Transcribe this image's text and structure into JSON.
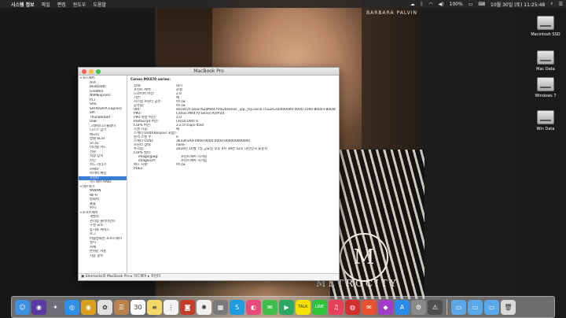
{
  "menubar": {
    "apple": "",
    "items": [
      "시스템 정보",
      "파일",
      "편집",
      "윈도우",
      "도움말"
    ],
    "battery": "100%",
    "clock": "10월 30일 (토) 11:25:48"
  },
  "wallpaper": {
    "brand": "BARBARA PALVIN",
    "logo": "M",
    "wordmark": "METROCITY"
  },
  "desktop": {
    "icons": [
      {
        "label": "Macintosh SSD"
      },
      {
        "label": "Mac Data"
      },
      {
        "label": "Windows 7"
      },
      {
        "label": "Win Data"
      }
    ]
  },
  "window": {
    "title": "MacBook Pro",
    "sidebar": [
      {
        "label": "하드웨어",
        "kind": "cat"
      },
      {
        "label": "ATA",
        "kind": "item"
      },
      {
        "label": "Bluetooth",
        "kind": "item"
      },
      {
        "label": "FireWire",
        "kind": "item"
      },
      {
        "label": "NVMExpress",
        "kind": "item"
      },
      {
        "label": "PCI",
        "kind": "item"
      },
      {
        "label": "SAS",
        "kind": "item"
      },
      {
        "label": "SATA/SATA Express",
        "kind": "item"
      },
      {
        "label": "SPI",
        "kind": "item"
      },
      {
        "label": "Thunderbolt",
        "kind": "item"
      },
      {
        "label": "USB",
        "kind": "item"
      },
      {
        "label": "그래픽/디스플레이",
        "kind": "item"
      },
      {
        "label": "디스크 굽기",
        "kind": "item"
      },
      {
        "label": "메모리",
        "kind": "item"
      },
      {
        "label": "병렬 SCSI",
        "kind": "item"
      },
      {
        "label": "오디오",
        "kind": "item"
      },
      {
        "label": "이더넷 카드",
        "kind": "item"
      },
      {
        "label": "전원",
        "kind": "item"
      },
      {
        "label": "저장 장치",
        "kind": "item"
      },
      {
        "label": "진단",
        "kind": "item"
      },
      {
        "label": "카드 리더기",
        "kind": "item"
      },
      {
        "label": "카메라",
        "kind": "item"
      },
      {
        "label": "파이버 채널",
        "kind": "item"
      },
      {
        "label": "프린터",
        "kind": "item",
        "selected": true
      },
      {
        "label": "하드웨어 RAID",
        "kind": "item"
      },
      {
        "label": "네트워크",
        "kind": "cat"
      },
      {
        "label": "WWAN",
        "kind": "item"
      },
      {
        "label": "Wi-Fi",
        "kind": "item"
      },
      {
        "label": "방화벽",
        "kind": "item"
      },
      {
        "label": "볼륨",
        "kind": "item"
      },
      {
        "label": "위치",
        "kind": "item"
      },
      {
        "label": "소프트웨어",
        "kind": "cat"
      },
      {
        "label": "개발자",
        "kind": "item"
      },
      {
        "label": "관리형 클라이언트",
        "kind": "item"
      },
      {
        "label": "구성 요소",
        "kind": "item"
      },
      {
        "label": "동기화 서비스",
        "kind": "item"
      },
      {
        "label": "로그",
        "kind": "item"
      },
      {
        "label": "비활성화된 소프트웨어",
        "kind": "item"
      },
      {
        "label": "설치",
        "kind": "item"
      },
      {
        "label": "서체",
        "kind": "item"
      },
      {
        "label": "손쉬운 사용",
        "kind": "item"
      },
      {
        "label": "시동 항목",
        "kind": "item"
      }
    ],
    "content": {
      "heading": "Canon MX470 series:",
      "properties": [
        {
          "k": "상태:",
          "v": "대기",
          "indent": 0
        },
        {
          "k": "프린트 서버:",
          "v": "로컬",
          "indent": 0
        },
        {
          "k": "드라이버 버전:",
          "v": "2.0",
          "indent": 0
        },
        {
          "k": "기본:",
          "v": "예",
          "indent": 0
        },
        {
          "k": "시스템 프린터 공유:",
          "v": "아니요",
          "indent": 0
        },
        {
          "k": "공유됨:",
          "v": "아니요",
          "indent": 0
        },
        {
          "k": "URI:",
          "v": "dnssd://Canon%20MX470%20series._ipp._tcp.local./?uuid=00000000-0000-1000-8000-F80D60E23D5A",
          "indent": 0
        },
        {
          "k": "PPD:",
          "v": "Canon MX470 series-AirPrint",
          "indent": 0
        },
        {
          "k": "PPD 파일 버전:",
          "v": "2.0",
          "indent": 0
        },
        {
          "k": "PostScript 버전:",
          "v": "(3010.000) 0",
          "indent": 0
        },
        {
          "k": "CUPS 버전:",
          "v": "2.2.0 (cups-450)",
          "indent": 0
        },
        {
          "k": "스캔 가능:",
          "v": "예",
          "indent": 0
        },
        {
          "k": "스캐너 UUID(Bonjour 포함):",
          "v": "-",
          "indent": 0
        },
        {
          "k": "원격 스캔 수:",
          "v": "0",
          "indent": 0
        },
        {
          "k": "스캐너 UUID:",
          "v": "3633A1A4-0000-0000-0000-000000000000",
          "indent": 0
        },
        {
          "k": "프린터 상태:",
          "v": "none",
          "indent": 0
        },
        {
          "k": "추가됨:",
          "v": "2016년 10월 7일 금요일 오후 4시 39분 52초 대한민국 표준시",
          "indent": 0
        },
        {
          "k": "CUPS 필터:",
          "v": "",
          "indent": 0
        },
        {
          "k": "image/jpeg:",
          "v": "프린트에서 허가됨",
          "indent": 1
        },
        {
          "k": "image/urf:",
          "v": "프린트에서 허가됨",
          "indent": 1
        },
        {
          "k": "팩스 지원:",
          "v": "아니요",
          "indent": 0
        },
        {
          "k": "PDEs:",
          "v": "",
          "indent": 0
        }
      ]
    },
    "statusbar": "▣ Sherlocks의 MacBook Pro ▸ 하드웨어 ▸ 프린터"
  },
  "dock": {
    "apps": [
      {
        "name": "finder-icon",
        "color": "#3d8fe0",
        "glyph": "☺"
      },
      {
        "name": "siri-icon",
        "color": "#5a3aa0",
        "glyph": "◉"
      },
      {
        "name": "launchpad-icon",
        "color": "#6d6d7a",
        "glyph": "✦"
      },
      {
        "name": "safari-icon",
        "color": "#2f8ee8",
        "glyph": "◎"
      },
      {
        "name": "chrome-icon",
        "color": "#d8a020",
        "glyph": "◉"
      },
      {
        "name": "photos-icon",
        "color": "#e0e0e0",
        "glyph": "✿"
      },
      {
        "name": "contacts-icon",
        "color": "#b8824a",
        "glyph": "☰"
      },
      {
        "name": "calendar-icon",
        "color": "#ffffff",
        "glyph": "30"
      },
      {
        "name": "notes-icon",
        "color": "#f5d86a",
        "glyph": "≡"
      },
      {
        "name": "reminders-icon",
        "color": "#f2f2f2",
        "glyph": "⋮"
      },
      {
        "name": "photo-booth-icon",
        "color": "#c83a2a",
        "glyph": "◙"
      },
      {
        "name": "photos-app-icon",
        "color": "#f0f0f0",
        "glyph": "✺"
      },
      {
        "name": "screenshot-icon",
        "color": "#7a7a7a",
        "glyph": "▦"
      },
      {
        "name": "skype-icon",
        "color": "#1e9ce0",
        "glyph": "S"
      },
      {
        "name": "camera-app-icon",
        "color": "#e84a7a",
        "glyph": "◐"
      },
      {
        "name": "messages-icon",
        "color": "#3fbf4a",
        "glyph": "✉"
      },
      {
        "name": "facetime-icon",
        "color": "#2aa860",
        "glyph": "▶"
      },
      {
        "name": "kakaotalk-icon",
        "color": "#f5e100",
        "glyph": "TALK"
      },
      {
        "name": "line-icon",
        "color": "#2ec43a",
        "glyph": "LINE"
      },
      {
        "name": "music-icon",
        "color": "#e8405a",
        "glyph": "♫"
      },
      {
        "name": "netease-icon",
        "color": "#d23030",
        "glyph": "◍"
      },
      {
        "name": "mail-app-icon",
        "color": "#e85030",
        "glyph": "✉"
      },
      {
        "name": "gamecenter-icon",
        "color": "#a23cc8",
        "glyph": "◆"
      },
      {
        "name": "app-store-icon",
        "color": "#2a8ae8",
        "glyph": "A"
      },
      {
        "name": "preferences-icon",
        "color": "#8a8a8a",
        "glyph": "⚙"
      },
      {
        "name": "activity-icon",
        "color": "#505050",
        "glyph": "⚠"
      }
    ],
    "trailing": [
      {
        "name": "folder-icon",
        "color": "#5aa8e8",
        "glyph": "▭"
      },
      {
        "name": "downloads-folder-icon",
        "color": "#5aa8e8",
        "glyph": "▭"
      },
      {
        "name": "documents-folder-icon",
        "color": "#5aa8e8",
        "glyph": "▭"
      },
      {
        "name": "trash-icon",
        "color": "#d8d8d8",
        "glyph": "🗑"
      }
    ]
  }
}
